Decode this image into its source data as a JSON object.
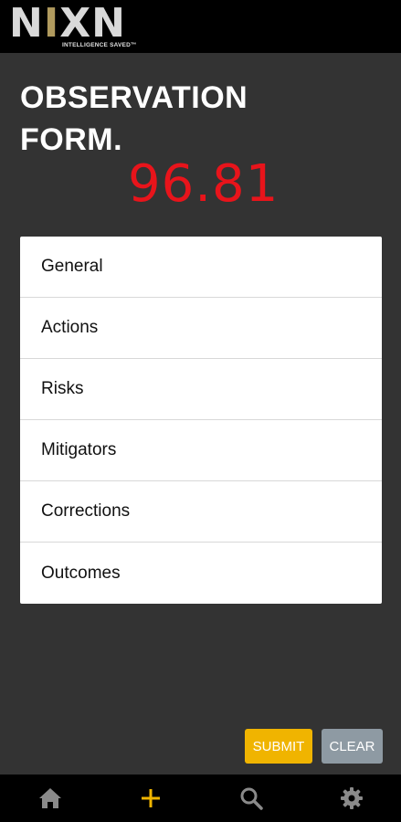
{
  "header": {
    "logo_word": "NIXN",
    "logo_tagline": "INTELLIGENCE SAVED™"
  },
  "page": {
    "title_line1": "OBSERVATION",
    "title_line2": "FORM.",
    "score": "96.81"
  },
  "menu": {
    "items": [
      {
        "label": "General"
      },
      {
        "label": "Actions"
      },
      {
        "label": "Risks"
      },
      {
        "label": "Mitigators"
      },
      {
        "label": "Corrections"
      },
      {
        "label": "Outcomes"
      }
    ]
  },
  "actions": {
    "submit_label": "SUBMIT",
    "clear_label": "CLEAR"
  },
  "bottom_nav": {
    "icons": [
      "home-icon",
      "plus-icon",
      "search-icon",
      "gear-icon"
    ]
  },
  "colors": {
    "score": "#e8141b",
    "accent": "#f0b400",
    "clear": "#8e9aa3",
    "background": "#333333"
  }
}
